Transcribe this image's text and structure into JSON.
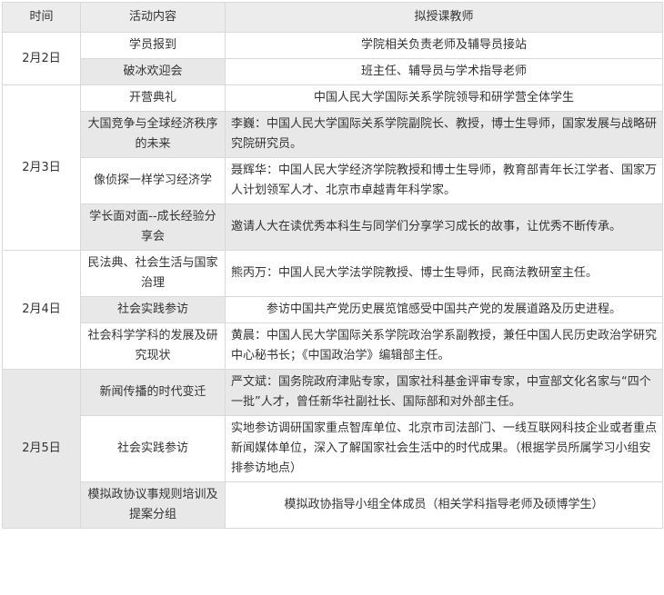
{
  "header": {
    "time": "时间",
    "activity": "活动内容",
    "teacher": "拟授课教师"
  },
  "groups": [
    {
      "date": "2月2日",
      "rows": [
        {
          "activity": "学员报到",
          "teacher": "学院相关负责老师及辅导员接站"
        },
        {
          "activity": "破冰欢迎会",
          "teacher": "班主任、辅导员与学术指导老师"
        }
      ]
    },
    {
      "date": "2月3日",
      "rows": [
        {
          "activity": "开营典礼",
          "teacher": "中国人民大学国际关系学院领导和研学营全体学生"
        },
        {
          "activity": "大国竞争与全球经济秩序的未来",
          "teacher": "李巍：中国人民大学国际关系学院副院长、教授，博士生导师，国家发展与战略研究院研究员。"
        },
        {
          "activity": "像侦探一样学习经济学",
          "teacher": "聂辉华：中国人民大学经济学院教授和博士生导师，教育部青年长江学者、国家万人计划领军人才、北京市卓越青年科学家。"
        },
        {
          "activity": "学长面对面--成长经验分享会",
          "teacher": "邀请人大在读优秀本科生与同学们分享学习成长的故事，让优秀不断传承。"
        }
      ]
    },
    {
      "date": "2月4日",
      "rows": [
        {
          "activity": "民法典、社会生活与国家治理",
          "teacher": "熊丙万：中国人民大学法学院教授、博士生导师，民商法教研室主任。"
        },
        {
          "activity": "社会实践参访",
          "teacher": "参访中国共产党历史展览馆感受中国共产党的发展道路及历史进程。"
        },
        {
          "activity": "社会科学学科的发展及研究现状",
          "teacher": "黄晨：中国人民大学国际关系学院政治学系副教授，兼任中国人民历史政治学研究中心秘书长；《中国政治学》编辑部主任。"
        }
      ]
    },
    {
      "date": "2月5日",
      "rows": [
        {
          "activity": "新闻传播的时代变迁",
          "teacher": "严文斌：国务院政府津贴专家，国家社科基金评审专家，中宣部文化名家与“四个一批”人才，曾任新华社副社长、国际部和对外部主任。"
        },
        {
          "activity": "社会实践参访",
          "teacher": "实地参访调研国家重点智库单位、北京市司法部门、一线互联网科技企业或者重点新闻媒体单位，深入了解国家社会生活中的时代成果。（根据学员所属学习小组安排参访地点）"
        },
        {
          "activity": "模拟政协议事规则培训及提案分组",
          "teacher": "模拟政协指导小组全体成员（相关学科指导老师及硕博学生）"
        }
      ]
    }
  ]
}
